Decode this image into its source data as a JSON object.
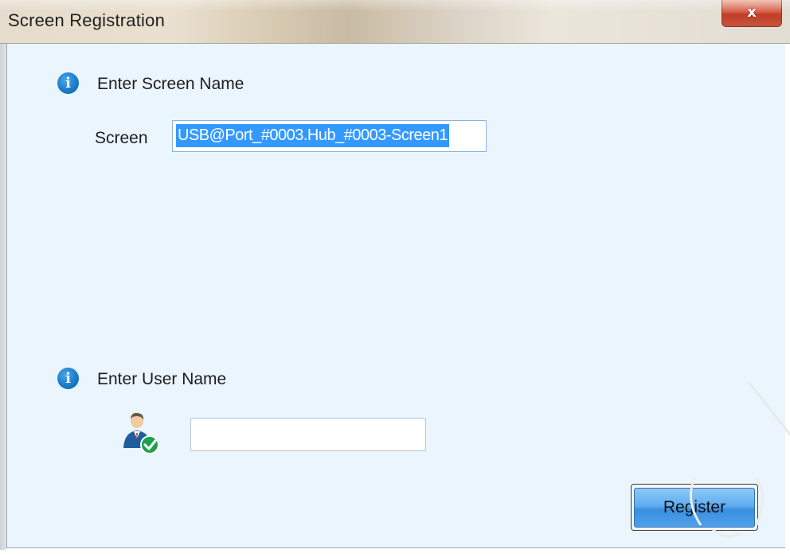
{
  "window": {
    "title": "Screen Registration",
    "close_label": "x"
  },
  "screen_section": {
    "heading": "Enter Screen Name",
    "field_label": "Screen",
    "value": "USB@Port_#0003.Hub_#0003-Screen1"
  },
  "user_section": {
    "heading": "Enter User Name",
    "value": ""
  },
  "actions": {
    "register_label": "Register"
  },
  "icons": {
    "info": "info-icon",
    "user": "user-check-icon",
    "close": "close-icon"
  },
  "colors": {
    "client_bg": "#ebf5fd",
    "selection": "#3399ff",
    "button_blue": "#4ea0ea",
    "info_blue": "#1a7ccb"
  }
}
